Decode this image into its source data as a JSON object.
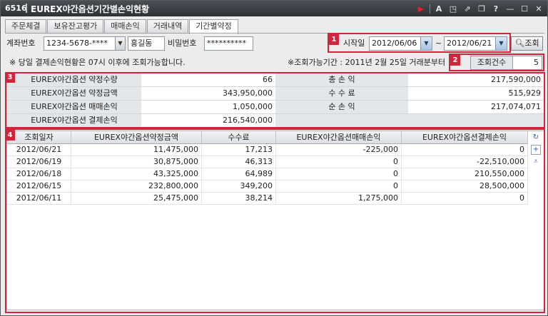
{
  "window": {
    "code": "6516",
    "title": "EUREX야간옵션기간별손익현황"
  },
  "tabs": [
    "주문체결",
    "보유잔고평가",
    "매매손익",
    "거래내역",
    "기간별약정"
  ],
  "filter": {
    "account_label": "계좌번호",
    "account_value": "1234-5678-****",
    "owner_name": "홍길동",
    "password_label": "비밀번호",
    "password_value": "**********",
    "start_label": "시작일",
    "start_date": "2012/06/06",
    "range_sep": "~",
    "end_date": "2012/06/21",
    "search_button": "조회"
  },
  "notice": {
    "left": "※ 당일 결제손익현황은 07시 이후에 조회가능합니다.",
    "right": "※조회가능기간 : 2011년 2월 25일 거래분부터",
    "count_label": "조회건수",
    "count_value": "5"
  },
  "badges": [
    "1",
    "2",
    "3",
    "4"
  ],
  "summary": {
    "rows": [
      {
        "label": "EUREX야간옵션 약정수량",
        "value": "66",
        "label2": "총 손 익",
        "value2": "217,590,000"
      },
      {
        "label": "EUREX야간옵션 약정금액",
        "value": "343,950,000",
        "label2": "수 수 료",
        "value2": "515,929"
      },
      {
        "label": "EUREX야간옵션 매매손익",
        "value": "1,050,000",
        "label2": "순 손 익",
        "value2": "217,074,071"
      },
      {
        "label": "EUREX야간옵션 결제손익",
        "value": "216,540,000",
        "label2": "",
        "value2": ""
      }
    ]
  },
  "grid": {
    "headers": [
      "조회일자",
      "EUREX야간옵션약정금액",
      "수수료",
      "EUREX야간옵션매매손익",
      "EUREX야간옵션결제손익"
    ],
    "rows": [
      [
        "2012/06/21",
        "11,475,000",
        "17,213",
        "-225,000",
        "0"
      ],
      [
        "2012/06/19",
        "30,875,000",
        "46,313",
        "0",
        "-22,510,000"
      ],
      [
        "2012/06/18",
        "43,325,000",
        "64,989",
        "0",
        "210,550,000"
      ],
      [
        "2012/06/15",
        "232,800,000",
        "349,200",
        "0",
        "28,500,000"
      ],
      [
        "2012/06/11",
        "25,475,000",
        "38,214",
        "1,275,000",
        "0"
      ]
    ]
  },
  "colors": {
    "accent_red": "#d2243b",
    "title_bar": "#2e3236"
  }
}
